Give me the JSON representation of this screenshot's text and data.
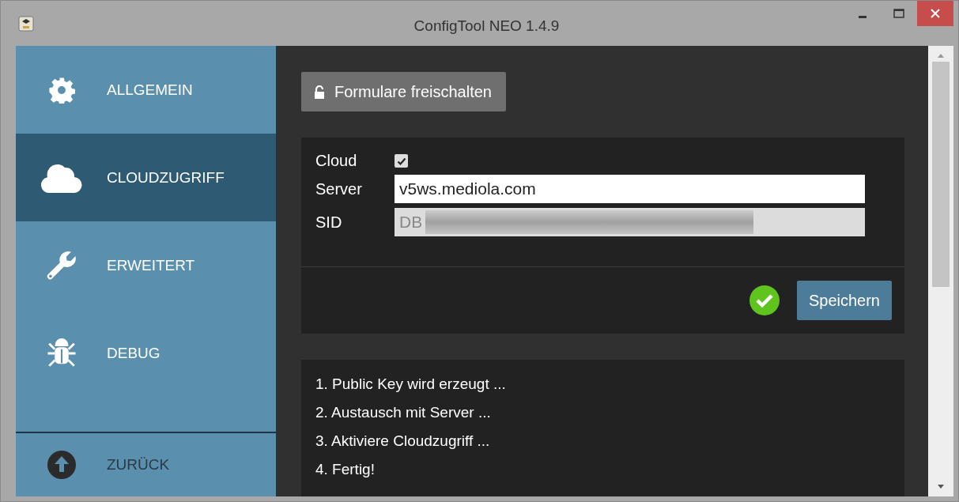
{
  "window": {
    "title": "ConfigTool NEO 1.4.9"
  },
  "sidebar": {
    "items": [
      {
        "label": "ALLGEMEIN",
        "kind": "gear",
        "selected": false
      },
      {
        "label": "CLOUDZUGRIFF",
        "kind": "cloud",
        "selected": true
      },
      {
        "label": "ERWEITERT",
        "kind": "wrench",
        "selected": false
      },
      {
        "label": "DEBUG",
        "kind": "bug",
        "selected": false
      }
    ],
    "back": {
      "label": "ZURÜCK"
    }
  },
  "unlock_button": {
    "label": "Formulare freischalten"
  },
  "form": {
    "cloud": {
      "label": "Cloud",
      "checked": true
    },
    "server": {
      "label": "Server",
      "value": "v5ws.mediola.com",
      "disabled": false
    },
    "sid": {
      "label": "SID",
      "value": "DB",
      "disabled": true,
      "redacted": true
    },
    "status_ok": true,
    "save_button": {
      "label": "Speichern"
    }
  },
  "log": {
    "lines": [
      "1. Public Key wird erzeugt ...",
      "2. Austausch mit Server ...",
      "3. Aktiviere Cloudzugriff ...",
      "4. Fertig!"
    ]
  }
}
